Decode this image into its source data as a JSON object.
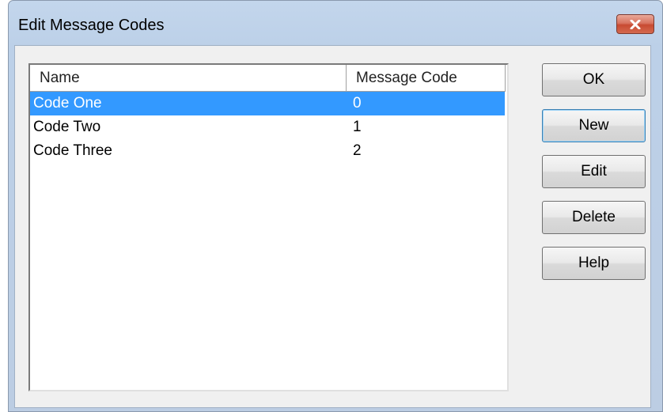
{
  "window": {
    "title": "Edit Message Codes"
  },
  "list": {
    "columns": [
      "Name",
      "Message Code"
    ],
    "rows": [
      {
        "name": "Code One",
        "code": "0",
        "selected": true
      },
      {
        "name": "Code Two",
        "code": "1",
        "selected": false
      },
      {
        "name": "Code Three",
        "code": "2",
        "selected": false
      }
    ]
  },
  "buttons": {
    "ok": "OK",
    "new": "New",
    "edit": "Edit",
    "delete": "Delete",
    "help": "Help"
  },
  "icons": {
    "close": "close-icon"
  },
  "colors": {
    "selection": "#3399ff",
    "close_button": "#c84a32",
    "title_bar": "#bcd0e8"
  }
}
